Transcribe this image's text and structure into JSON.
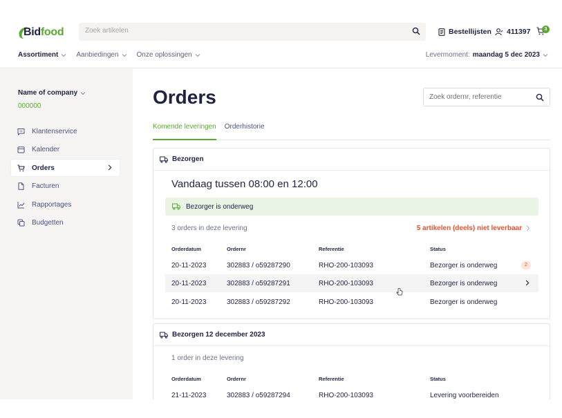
{
  "brand": {
    "logo_text_a": "Bid",
    "logo_text_b": "food",
    "accent": "#5aa832",
    "text": "#1f2340",
    "warning": "#e8502e"
  },
  "header": {
    "search_placeholder": "Zoek artikelen",
    "order_lists_label": "Bestellijsten",
    "account_label": "411397",
    "cart_count": "3",
    "icons": [
      "search-icon",
      "list-icon",
      "user-icon",
      "cart-icon"
    ]
  },
  "nav": {
    "items": [
      {
        "label": "Assortiment"
      },
      {
        "label": "Aanbiedingen"
      },
      {
        "label": "Onze oplossingen"
      }
    ],
    "delivery_label": "Levermoment:",
    "delivery_value": "maandag 5 dec 2023"
  },
  "sidebar": {
    "company_name": "Name of company",
    "company_number": "000000",
    "items": [
      {
        "label": "Klantenservice",
        "icon": "chat-icon"
      },
      {
        "label": "Kalender",
        "icon": "calendar-icon"
      },
      {
        "label": "Orders",
        "icon": "cart-icon"
      },
      {
        "label": "Facturen",
        "icon": "document-icon"
      },
      {
        "label": "Rapportages",
        "icon": "chart-icon"
      },
      {
        "label": "Budgetten",
        "icon": "budget-icon"
      }
    ]
  },
  "main": {
    "title": "Orders",
    "search_placeholder": "Zoek ordernr, referentie",
    "tabs": [
      {
        "label": "Komende leveringen"
      },
      {
        "label": "Orderhistorie"
      }
    ]
  },
  "deliveries": [
    {
      "heading": "Bezorgen",
      "time_slot": "Vandaag tussen 08:00 en 12:00",
      "status_banner": "Bezorger is onderweg",
      "order_count": "3 orders in deze levering",
      "warning": "5 artikelen (deels) niet leverbaar",
      "columns": [
        "Orderdatum",
        "Ordernr",
        "Referentie",
        "Status"
      ],
      "rows": [
        {
          "date": "20-11-2023",
          "order": "302883 / o59287290",
          "reference": "RHO-200-103093",
          "status": "Bezorger is onderweg",
          "badge": "2"
        },
        {
          "date": "20-11-2023",
          "order": "302883 / o59287291",
          "reference": "RHO-200-103093",
          "status": "Bezorger is onderweg"
        },
        {
          "date": "20-11-2023",
          "order": "302883 / o59287292",
          "reference": "RHO-200-103093",
          "status": "Bezorger is onderweg"
        }
      ]
    },
    {
      "heading": "Bezorgen 12 december 2023",
      "order_count": "1 order in deze levering",
      "columns": [
        "Orderdatum",
        "Ordernr",
        "Referentie",
        "Status"
      ],
      "rows": [
        {
          "date": "21-11-2023",
          "order": "302883 / o59287294",
          "reference": "RHO-200-103093",
          "status": "Levering voorbereiden"
        }
      ]
    }
  ]
}
